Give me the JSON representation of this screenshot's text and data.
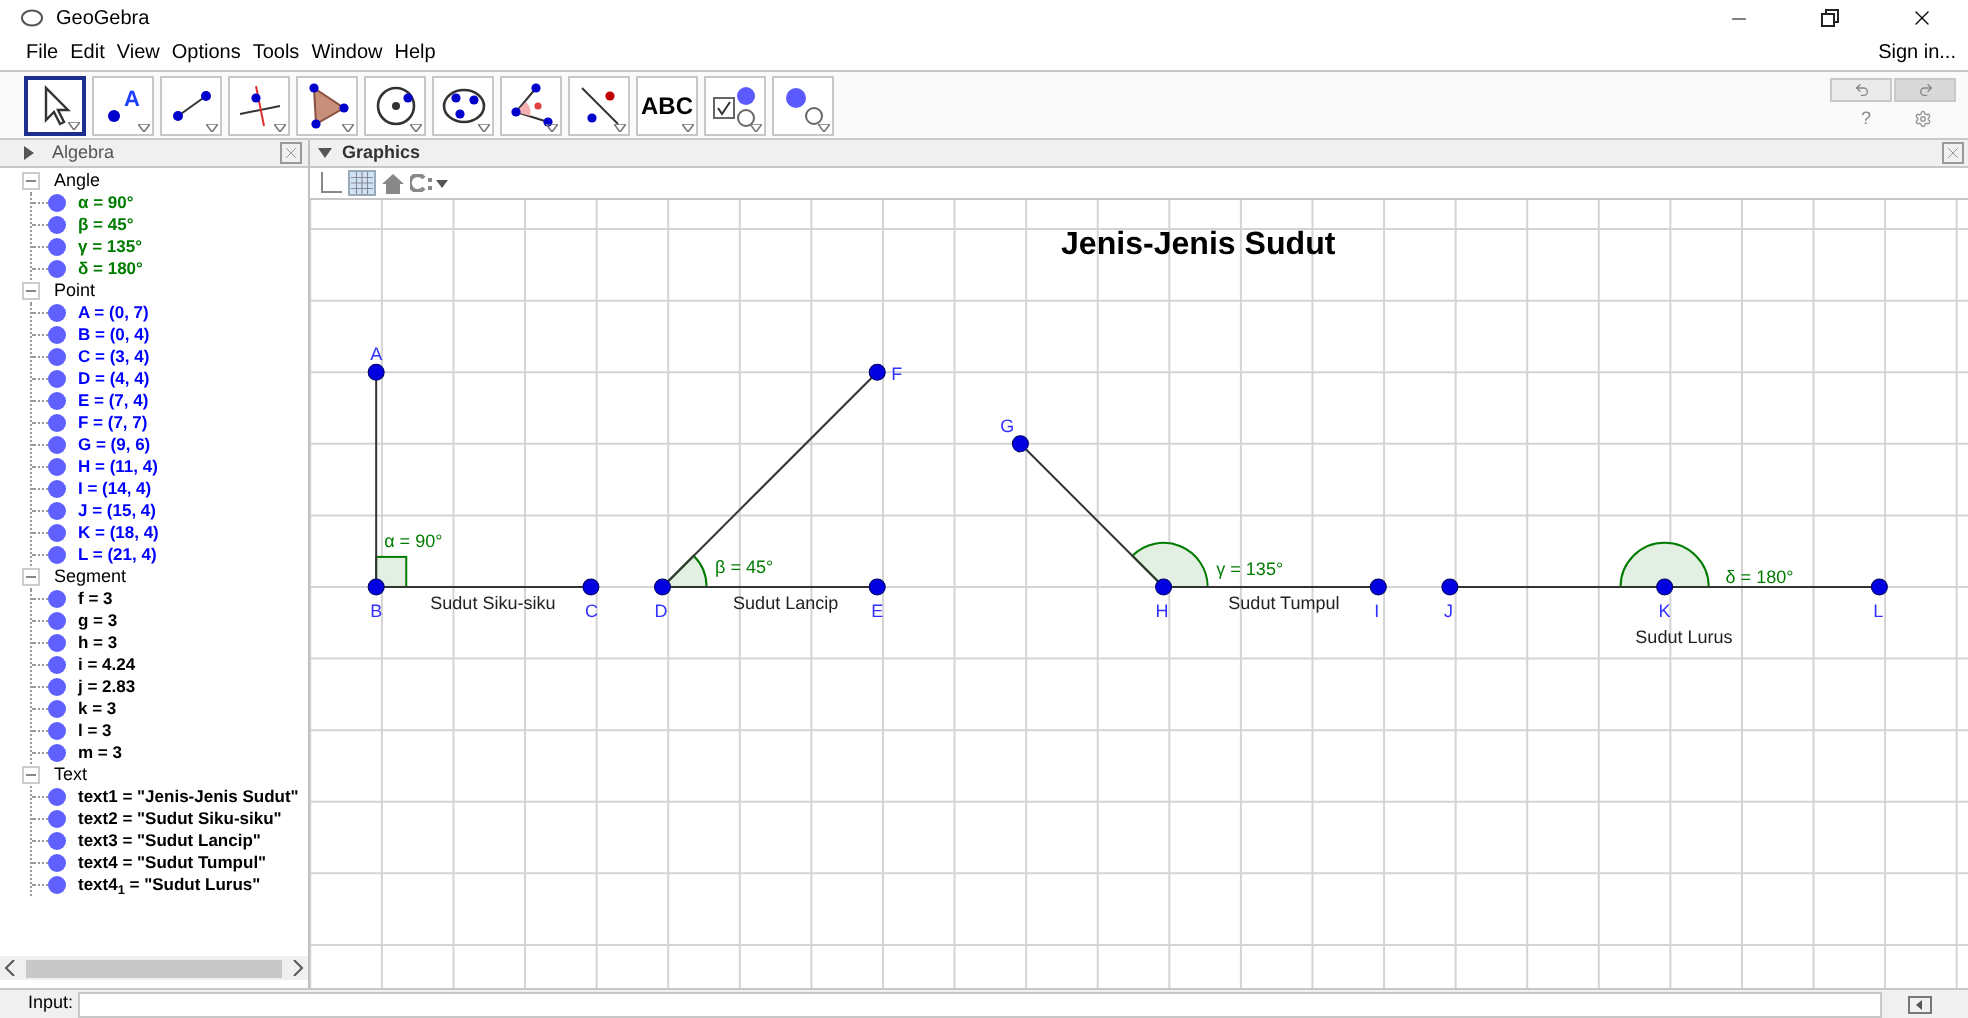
{
  "window": {
    "title": "GeoGebra"
  },
  "menu": [
    "File",
    "Edit",
    "View",
    "Options",
    "Tools",
    "Window",
    "Help"
  ],
  "sign_in": "Sign in...",
  "toolbar": [
    {
      "kind": "move",
      "selected": true
    },
    {
      "kind": "point",
      "label": "A",
      "selected": false
    },
    {
      "kind": "line",
      "selected": false
    },
    {
      "kind": "perpendicular",
      "selected": false
    },
    {
      "kind": "polygon",
      "selected": false
    },
    {
      "kind": "circle",
      "selected": false
    },
    {
      "kind": "conic",
      "selected": false
    },
    {
      "kind": "angle",
      "selected": false
    },
    {
      "kind": "reflect",
      "selected": false
    },
    {
      "kind": "text",
      "label": "ABC",
      "selected": false
    },
    {
      "kind": "slider",
      "selected": false
    },
    {
      "kind": "showhide",
      "selected": false
    }
  ],
  "help": "?",
  "algebra": {
    "title": "Algebra",
    "groups": [
      {
        "name": "Angle",
        "color": "#007c00",
        "items": [
          "α = 90°",
          "β = 45°",
          "γ = 135°",
          "δ = 180°"
        ]
      },
      {
        "name": "Point",
        "color": "#0000ff",
        "items": [
          "A = (0, 7)",
          "B = (0, 4)",
          "C = (3, 4)",
          "D = (4, 4)",
          "E = (7, 4)",
          "F = (7, 7)",
          "G = (9, 6)",
          "H = (11, 4)",
          "I = (14, 4)",
          "J = (15, 4)",
          "K = (18, 4)",
          "L = (21, 4)"
        ]
      },
      {
        "name": "Segment",
        "color": "#000000",
        "items": [
          "f = 3",
          "g = 3",
          "h = 3",
          "i = 4.24",
          "j = 2.83",
          "k = 3",
          "l = 3",
          "m = 3"
        ]
      },
      {
        "name": "Text",
        "color": "#000000",
        "items": [
          "text1 = \"Jenis-Jenis Sudut\"",
          "text2 = \"Sudut Siku-siku\"",
          "text3 = \"Sudut Lancip\"",
          "text4 = \"Sudut Tumpul\"",
          "text4$_{1}$ = \"Sudut Lurus\""
        ]
      }
    ]
  },
  "graphics": {
    "title": "Graphics",
    "heading": "Jenis-Jenis Sudut",
    "points": [
      "A",
      "B",
      "C",
      "D",
      "E",
      "F",
      "G",
      "H",
      "I",
      "J",
      "K",
      "L"
    ],
    "angles": [
      {
        "kind": "right",
        "label": "α = 90°"
      },
      {
        "kind": "arc",
        "label": "β = 45°"
      },
      {
        "kind": "arc",
        "label": "γ = 135°"
      },
      {
        "kind": "arc",
        "label": "δ = 180°"
      }
    ],
    "captions": [
      "Sudut Siku-siku",
      "Sudut Lancip",
      "Sudut Tumpul",
      "Sudut Lurus"
    ]
  },
  "input": {
    "label": "Input:"
  }
}
